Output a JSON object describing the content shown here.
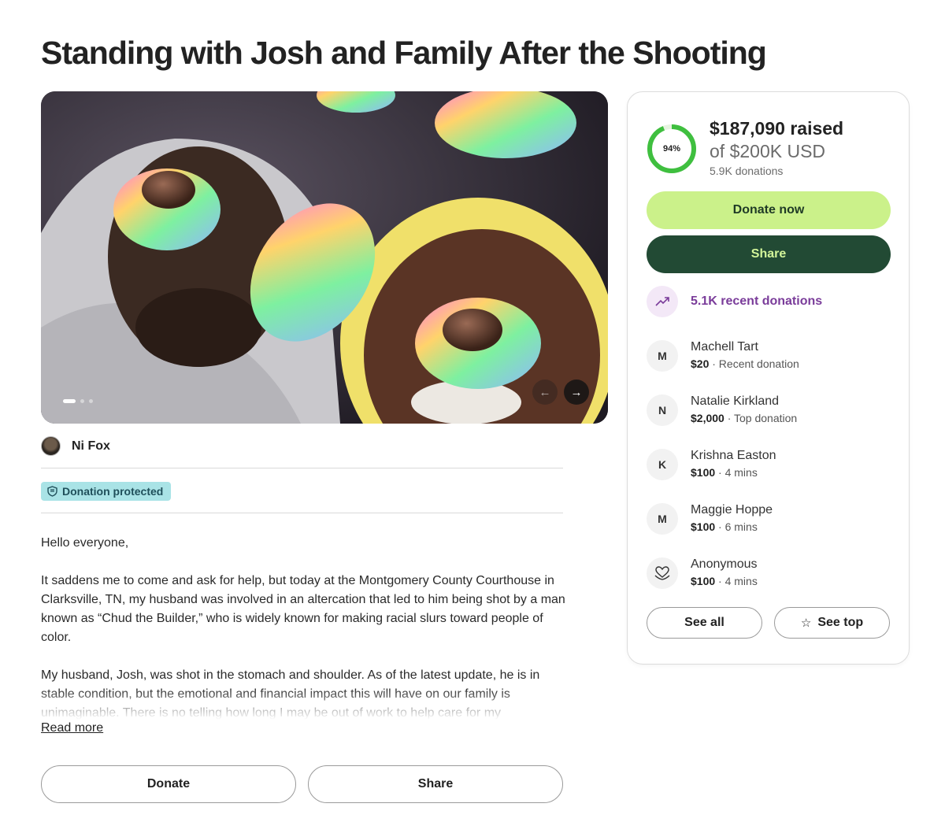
{
  "page": {
    "title": "Standing with Josh and Family After the Shooting"
  },
  "hero": {
    "dots": 3,
    "active_dot": 0,
    "prev_icon": "arrow-left-icon",
    "next_icon": "arrow-right-icon"
  },
  "organizer": {
    "name": "Ni Fox"
  },
  "badge": {
    "label": "Donation protected",
    "icon": "shield-icon"
  },
  "story": {
    "greeting": "Hello everyone,",
    "p1": "It saddens me to come and ask for help, but today at the Montgomery County Courthouse in Clarksville, TN, my husband was involved in an altercation that led to him being shot by a man known as “Chud the Builder,” who is widely known for making racial slurs toward people of color.",
    "p2": "My husband, Josh, was shot in the stomach and shoulder. As of the latest update, he is in stable condition, but the emotional and financial impact this will have on our family is unimaginable. There is no telling how long I may be out of work to help care for my",
    "read_more": "Read more"
  },
  "actions": {
    "donate": "Donate",
    "share": "Share"
  },
  "card": {
    "progress_percent": 94,
    "progress_label": "94%",
    "raised": "$187,090 raised",
    "goal": "of $200K USD",
    "donations": "5.9K donations",
    "donate_now": "Donate now",
    "share": "Share",
    "recent_donations": "5.1K recent donations",
    "donors": [
      {
        "initial": "M",
        "name": "Machell Tart",
        "amount": "$20",
        "note": " · Recent donation"
      },
      {
        "initial": "N",
        "name": "Natalie Kirkland",
        "amount": "$2,000",
        "note": " · Top donation"
      },
      {
        "initial": "K",
        "name": "Krishna Easton",
        "amount": "$100",
        "note": " · 4 mins"
      },
      {
        "initial": "M",
        "name": "Maggie Hoppe",
        "amount": "$100",
        "note": " · 6 mins"
      },
      {
        "initial": "",
        "name": "Anonymous",
        "amount": "$100",
        "note": " · 4 mins",
        "icon": "heart-hand-icon"
      }
    ],
    "see_all": "See all",
    "see_top": "See top"
  },
  "colors": {
    "accent_green": "#cbf18a",
    "dark_green": "#224a34",
    "ring_green": "#3fbf3f",
    "purple": "#7a3c9a",
    "badge_bg": "#a9e3e6"
  }
}
